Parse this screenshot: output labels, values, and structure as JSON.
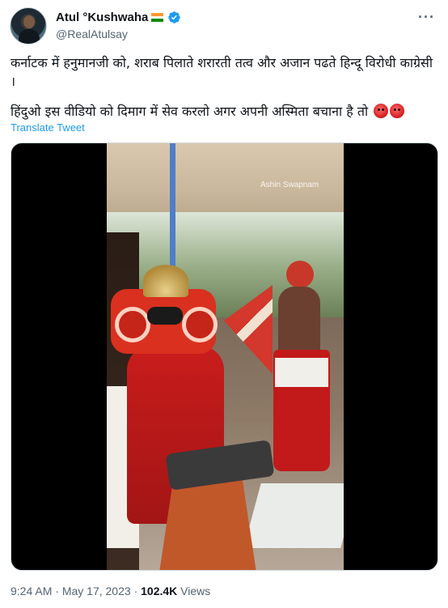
{
  "author": {
    "display_name": "Atul °Kushwaha",
    "handle": "@RealAtulsay",
    "flag_icon": "india-flag-icon",
    "verified_icon": "verified-badge-icon",
    "verified_color": "#1d9bf0"
  },
  "more_label": "···",
  "tweet": {
    "para1": "कर्नाटक में हनुमानजी को, शराब पिलाते शरारती  तत्व और अजान पढते हिन्दू  विरोधी काग्रेसी ।",
    "para2": "हिंदुओ इस वीडियो को दिमाग में सेव करलो अगर अपनी अस्मिता बचाना है तो",
    "emoji": [
      "angry-face-emoji",
      "angry-face-emoji"
    ]
  },
  "translate_label": "Translate Tweet",
  "media": {
    "watermark": "Ashin Swapnam"
  },
  "meta": {
    "time": "9:24 AM",
    "separator": "·",
    "date": "May 17, 2023",
    "views_count": "102.4K",
    "views_label": "Views"
  },
  "colors": {
    "accent": "#1d9bf0",
    "text": "#0f1419",
    "muted": "#536471"
  }
}
